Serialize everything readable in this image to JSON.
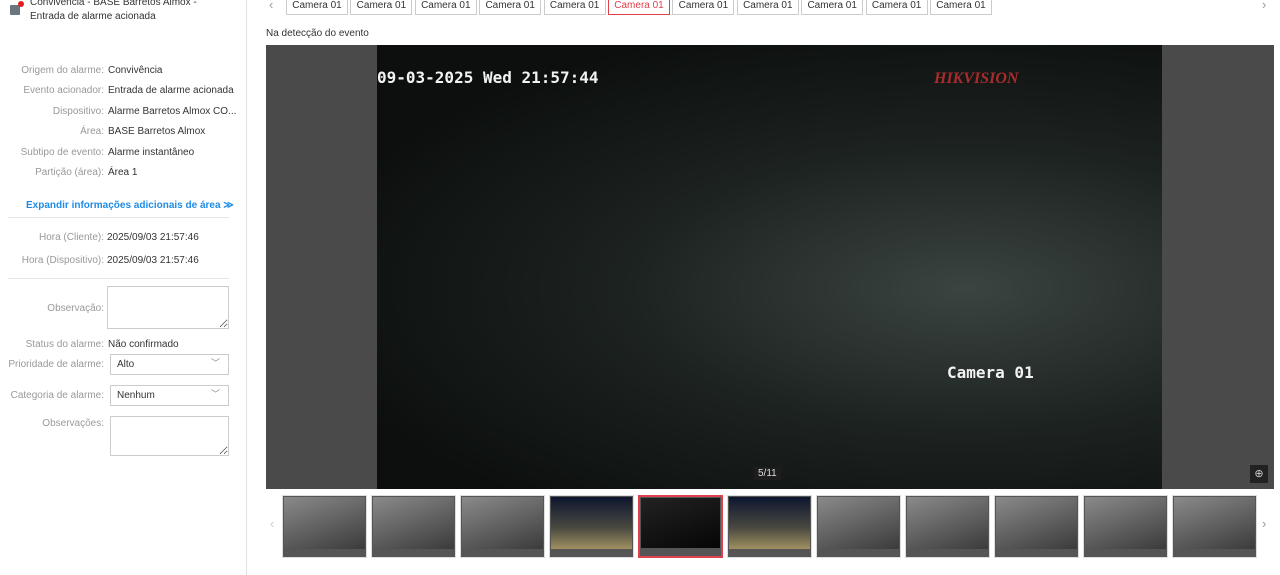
{
  "left": {
    "title": "Convivência - BASE Barretos Almox - Entrada de alarme acionada",
    "details": [
      {
        "k": "Origem do alarme:",
        "v": "Convivência"
      },
      {
        "k": "Evento acionador:",
        "v": "Entrada de alarme acionada"
      },
      {
        "k": "Dispositivo:",
        "v": "Alarme Barretos Almox CO..."
      },
      {
        "k": "Área:",
        "v": "BASE Barretos Almox"
      },
      {
        "k": "Subtipo de evento:",
        "v": "Alarme instantâneo"
      },
      {
        "k": "Partição (área):",
        "v": "Área 1"
      }
    ],
    "expand": "Expandir informações adicionais de área ≫",
    "times": [
      {
        "k": "Hora (Cliente):",
        "v": "2025/09/03 21:57:46"
      },
      {
        "k": "Hora (Dispositivo):",
        "v": "2025/09/03 21:57:46"
      }
    ],
    "observacao_label": "Observação:",
    "status_label": "Status do alarme:",
    "status_value": "Não confirmado",
    "prioridade_label": "Prioridade de alarme:",
    "prioridade_value": "Alto",
    "categoria_label": "Categoria de alarme:",
    "categoria_value": "Nenhum",
    "observacoes_label": "Observações:"
  },
  "tabs": [
    "Camera 01",
    "Camera 01",
    "Camera 01",
    "Camera 01",
    "Camera 01",
    "Camera 01",
    "Camera 01",
    "Camera 01",
    "Camera 01",
    "Camera 01",
    "Camera 01"
  ],
  "active_tab": 5,
  "subtitle": "Na detecção do evento",
  "video": {
    "timestamp": "09-03-2025 Wed 21:57:44",
    "camera_label": "Camera 01",
    "logo": "HIKVISION",
    "counter": "5/11"
  },
  "thumbnails": {
    "count": 11,
    "active": 4
  },
  "colors": {
    "accent": "#e0404a",
    "link": "#1e8ce6"
  }
}
